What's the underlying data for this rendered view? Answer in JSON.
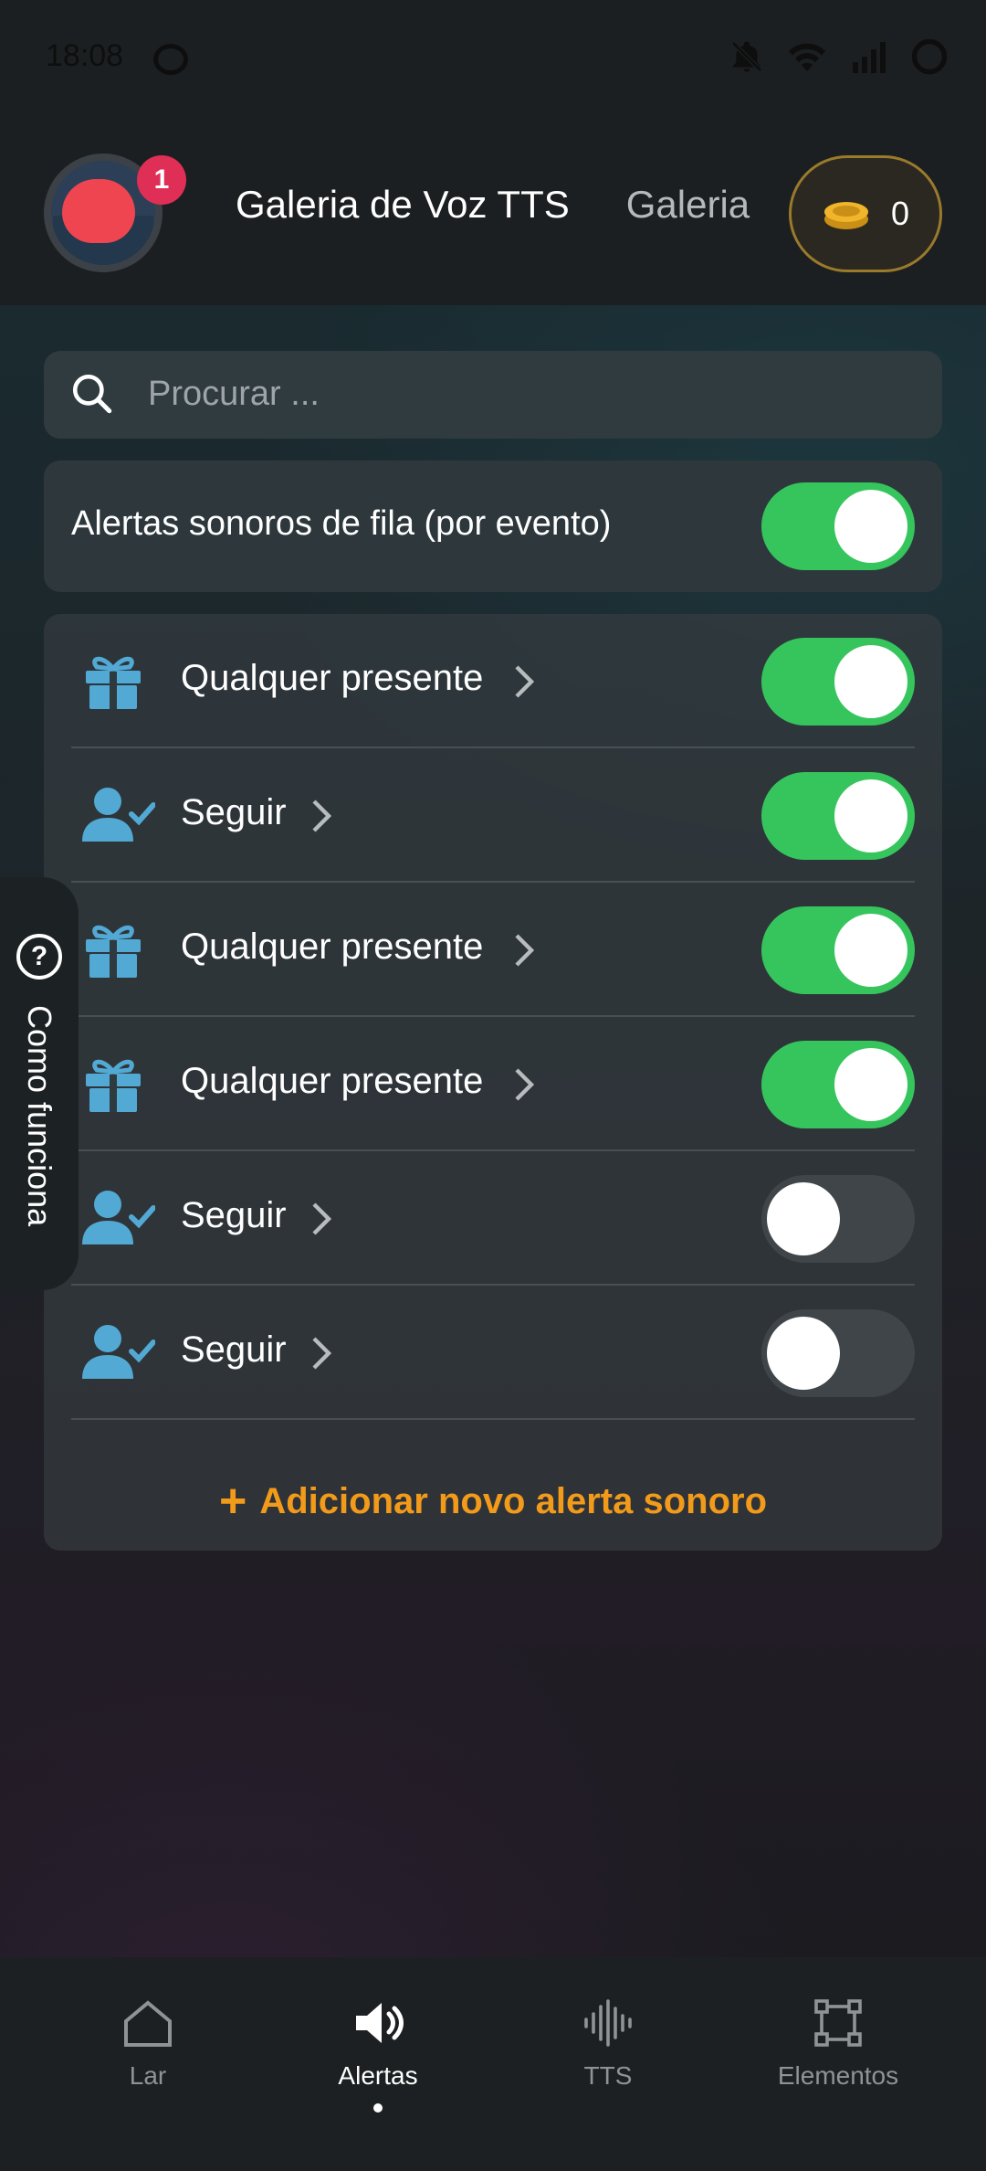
{
  "status_bar": {
    "time": "18:08",
    "icons": [
      "camera-record-icon",
      "bell-off-icon",
      "wifi-icon",
      "signal-icon",
      "battery-ring-icon"
    ]
  },
  "header": {
    "badge_count": "1",
    "tabs": [
      {
        "label": "Galeria de Voz TTS"
      },
      {
        "label": "Galeria"
      }
    ],
    "coins": "0"
  },
  "search": {
    "placeholder": "Procurar ..."
  },
  "queue_toggle": {
    "label": "Alertas sonoros de fila (por evento)",
    "on": true
  },
  "alerts": [
    {
      "label": "Qualquer presente",
      "icon": "gift-icon",
      "on": true
    },
    {
      "label": "Seguir",
      "icon": "user-check-icon",
      "on": true
    },
    {
      "label": "Qualquer presente",
      "icon": "gift-icon",
      "on": true
    },
    {
      "label": "Qualquer presente",
      "icon": "gift-icon",
      "on": true
    },
    {
      "label": "Seguir",
      "icon": "user-check-icon",
      "on": false
    },
    {
      "label": "Seguir",
      "icon": "user-check-icon",
      "on": false
    }
  ],
  "add_alert_label": "Adicionar novo alerta sonoro",
  "help_tab": {
    "icon_glyph": "?",
    "label": "Como funciona"
  },
  "nav": [
    {
      "label": "Lar",
      "icon": "home-icon",
      "active": false
    },
    {
      "label": "Alertas",
      "icon": "speaker-icon",
      "active": true
    },
    {
      "label": "TTS",
      "icon": "waveform-icon",
      "active": false
    },
    {
      "label": "Elementos",
      "icon": "frame-icon",
      "active": false
    }
  ],
  "colors": {
    "accent_green": "#36c55c",
    "accent_orange": "#f29a1a",
    "icon_blue": "#52a9d4",
    "badge_red": "#e02f56",
    "coin_gold": "#e8b12a"
  }
}
